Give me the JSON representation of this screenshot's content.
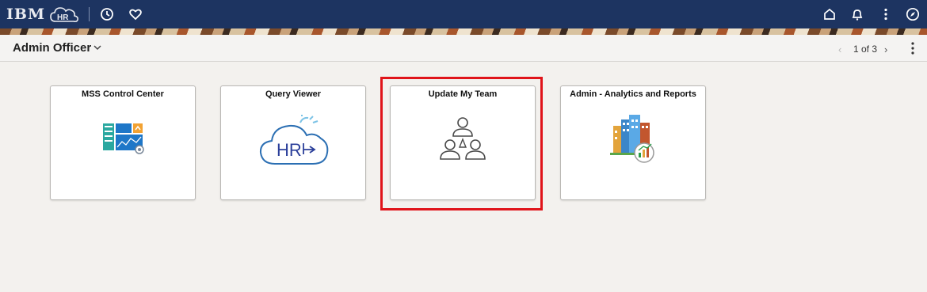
{
  "topbar": {
    "logo_text": "IBM",
    "logo_badge": "HR",
    "left_icons": [
      "clock-icon",
      "heart-icon"
    ],
    "right_icons": [
      "home-icon",
      "bell-icon",
      "kebab-menu-icon",
      "compass-icon"
    ],
    "background": "#1d3461"
  },
  "header": {
    "title": "Admin Officer",
    "pager_text": "1 of 3"
  },
  "tiles": [
    {
      "title": "MSS Control Center",
      "icon": "dashboard-icon"
    },
    {
      "title": "Query Viewer",
      "icon": "hr-cloud-icon"
    },
    {
      "title": "Update My Team",
      "icon": "team-icon"
    },
    {
      "title": "Admin - Analytics and Reports",
      "icon": "buildings-chart-icon"
    }
  ],
  "highlight": {
    "target": "Update My Team",
    "color": "#e0141a"
  }
}
